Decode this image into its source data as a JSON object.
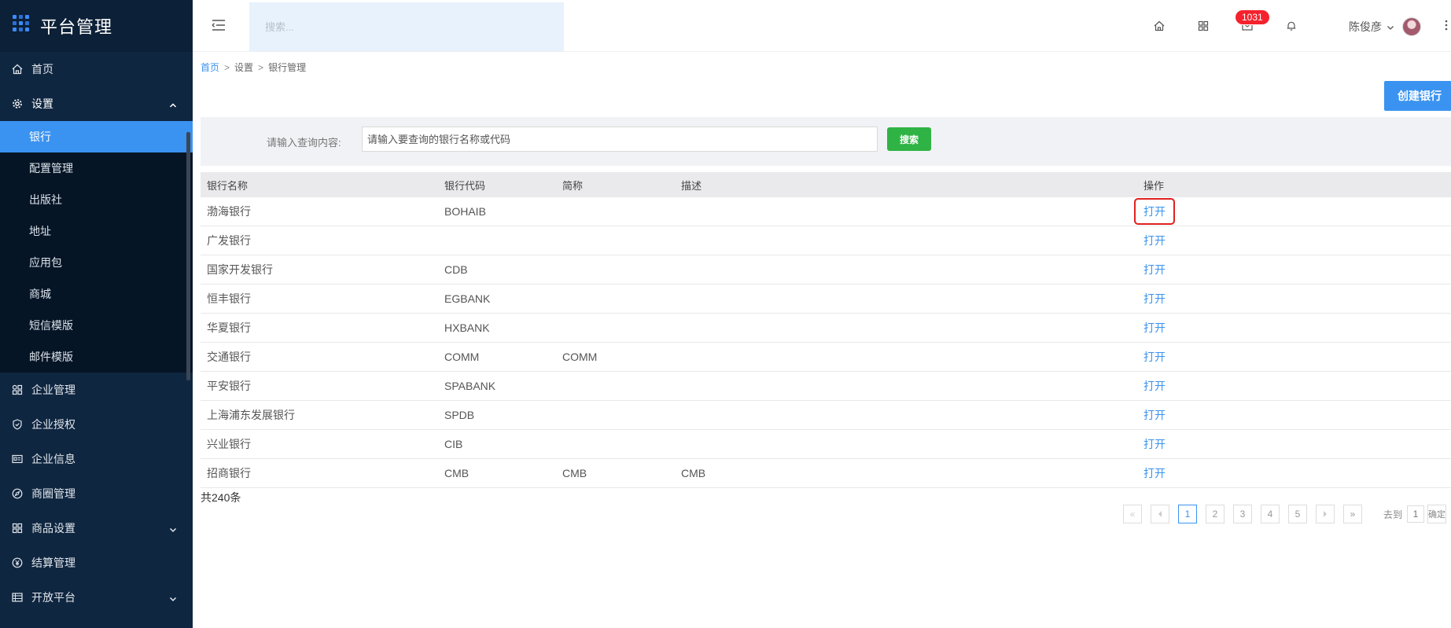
{
  "app": {
    "title": "平台管理"
  },
  "sidebar": {
    "items": [
      {
        "label": "首页",
        "icon": "home-icon"
      },
      {
        "label": "设置",
        "icon": "gear-icon",
        "expanded": true,
        "children": [
          "银行",
          "配置管理",
          "出版社",
          "地址",
          "应用包",
          "商城",
          "短信模版",
          "邮件模版"
        ],
        "active_child": "银行"
      },
      {
        "label": "企业管理",
        "icon": "apps-icon"
      },
      {
        "label": "企业授权",
        "icon": "shield-icon"
      },
      {
        "label": "企业信息",
        "icon": "id-card-icon"
      },
      {
        "label": "商圈管理",
        "icon": "compass-icon"
      },
      {
        "label": "商品设置",
        "icon": "grid-icon",
        "has_children": true
      },
      {
        "label": "结算管理",
        "icon": "yen-icon"
      },
      {
        "label": "开放平台",
        "icon": "table-icon",
        "has_children": true
      }
    ]
  },
  "header": {
    "search_placeholder": "搜索...",
    "message_badge": "1031",
    "user_name": "陈俊彦"
  },
  "breadcrumb": {
    "home": "首页",
    "level1": "设置",
    "level2": "银行管理",
    "sep": ">"
  },
  "actions": {
    "create_label": "创建银行"
  },
  "filter": {
    "label": "请输入查询内容:",
    "placeholder": "请输入要查询的银行名称或代码",
    "search_label": "搜索"
  },
  "table": {
    "columns": [
      "银行名称",
      "银行代码",
      "简称",
      "描述",
      "操作"
    ],
    "rows": [
      {
        "name": "渤海银行",
        "code": "BOHAIB",
        "short": "",
        "desc": "",
        "action": "打开"
      },
      {
        "name": "广发银行",
        "code": "",
        "short": "",
        "desc": "",
        "action": "打开"
      },
      {
        "name": "国家开发银行",
        "code": "CDB",
        "short": "",
        "desc": "",
        "action": "打开"
      },
      {
        "name": "恒丰银行",
        "code": "EGBANK",
        "short": "",
        "desc": "",
        "action": "打开"
      },
      {
        "name": "华夏银行",
        "code": "HXBANK",
        "short": "",
        "desc": "",
        "action": "打开"
      },
      {
        "name": "交通银行",
        "code": "COMM",
        "short": "COMM",
        "desc": "",
        "action": "打开"
      },
      {
        "name": "平安银行",
        "code": "SPABANK",
        "short": "",
        "desc": "",
        "action": "打开"
      },
      {
        "name": "上海浦东发展银行",
        "code": "SPDB",
        "short": "",
        "desc": "",
        "action": "打开"
      },
      {
        "name": "兴业银行",
        "code": "CIB",
        "short": "",
        "desc": "",
        "action": "打开"
      },
      {
        "name": "招商银行",
        "code": "CMB",
        "short": "CMB",
        "desc": "CMB",
        "action": "打开"
      }
    ],
    "total": "共240条"
  },
  "pagination": {
    "first": "«",
    "last": "»",
    "pages": [
      "1",
      "2",
      "3",
      "4",
      "5"
    ],
    "current": "1",
    "goto_label": "去到",
    "goto_value": "1",
    "confirm_label": "确定"
  },
  "colors": {
    "accent": "#3a93f0",
    "sidebar_bg": "#0f2640",
    "search_button": "#2fb344",
    "badge": "#f5222d"
  }
}
